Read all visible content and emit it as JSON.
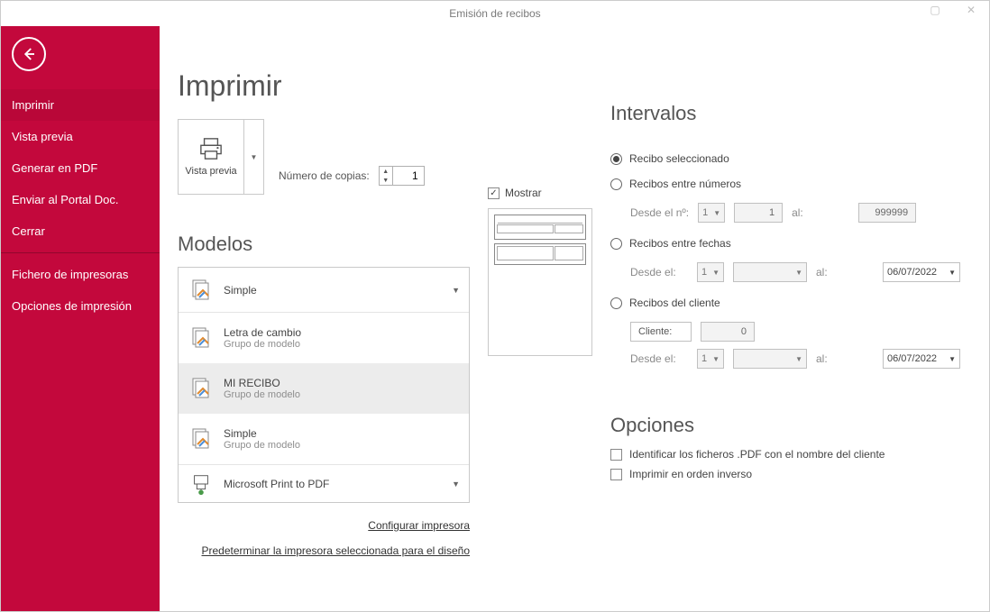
{
  "window": {
    "title": "Emisión de recibos"
  },
  "sidebar": {
    "items": [
      "Imprimir",
      "Vista previa",
      "Generar en PDF",
      "Enviar al Portal Doc.",
      "Cerrar"
    ],
    "items2": [
      "Fichero de impresoras",
      "Opciones de impresión"
    ]
  },
  "page_title": "Imprimir",
  "preview_button": {
    "label": "Vista previa"
  },
  "copies": {
    "label": "Número de copias:",
    "value": "1"
  },
  "models": {
    "heading": "Modelos",
    "selected": "Simple",
    "items": [
      {
        "title": "Letra de cambio",
        "sub": "Grupo de modelo"
      },
      {
        "title": "MI RECIBO",
        "sub": "Grupo de modelo"
      },
      {
        "title": "Simple",
        "sub": "Grupo de modelo"
      }
    ],
    "printer": "Microsoft Print to PDF"
  },
  "links": {
    "configure": "Configurar impresora",
    "default": "Predeterminar la impresora seleccionada para el diseño"
  },
  "show_label": "Mostrar",
  "intervals": {
    "heading": "Intervalos",
    "r1": "Recibo seleccionado",
    "r2": "Recibos entre números",
    "r2_from_lbl": "Desde el nº:",
    "r2_from_combo": "1",
    "r2_from_val": "1",
    "r2_to_lbl": "al:",
    "r2_to_val": "999999",
    "r3": "Recibos entre fechas",
    "r3_from_lbl": "Desde el:",
    "r3_from_combo": "1",
    "r3_to_lbl": "al:",
    "r3_to_val": "06/07/2022",
    "r4": "Recibos del cliente",
    "r4_cli_lbl": "Cliente:",
    "r4_cli_val": "0",
    "r4_from_lbl": "Desde el:",
    "r4_from_combo": "1",
    "r4_to_lbl": "al:",
    "r4_to_val": "06/07/2022"
  },
  "options": {
    "heading": "Opciones",
    "o1": "Identificar los ficheros .PDF con el nombre del cliente",
    "o2": "Imprimir en orden inverso"
  }
}
